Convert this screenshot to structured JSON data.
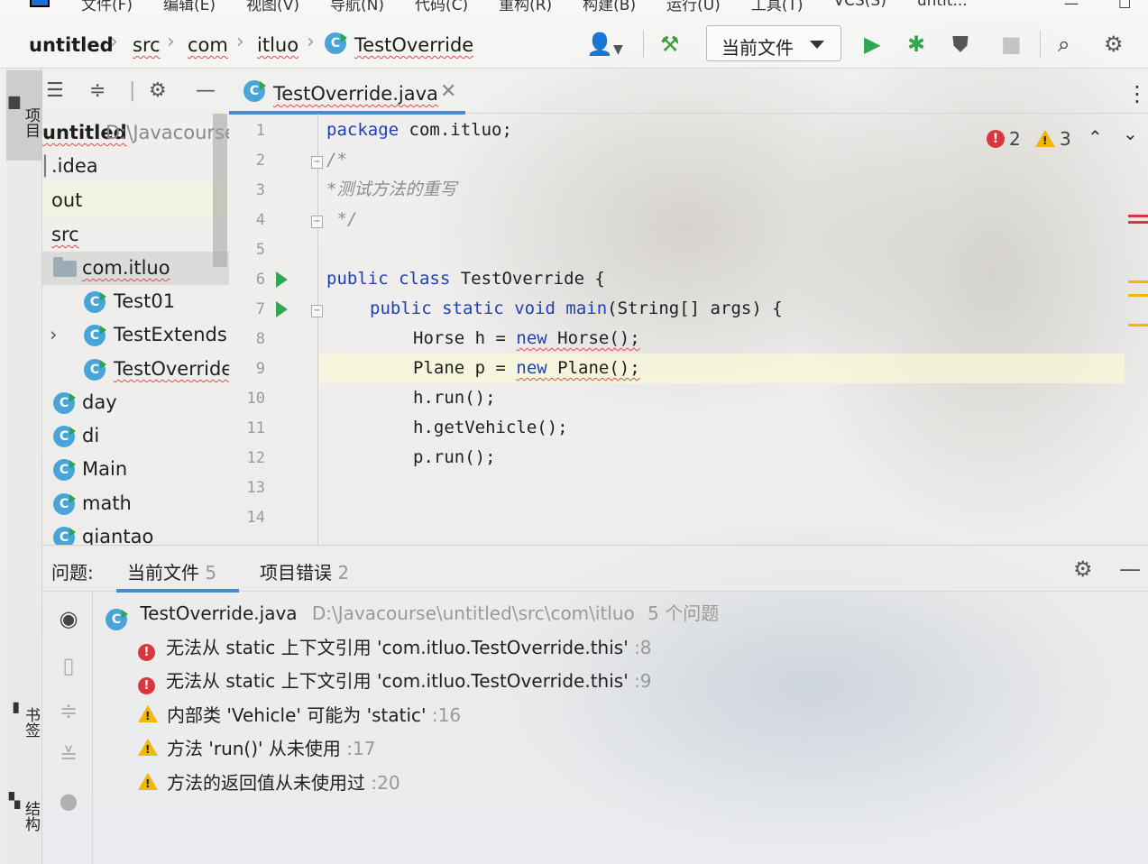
{
  "menubar": {
    "items": [
      "文件(F)",
      "编辑(E)",
      "视图(V)",
      "导航(N)",
      "代码(C)",
      "重构(R)",
      "构建(B)",
      "运行(U)",
      "工具(T)",
      "VCS(S)",
      "untit..."
    ]
  },
  "breadcrumb": {
    "items": [
      "untitled",
      "src",
      "com",
      "itluo",
      "TestOverride"
    ]
  },
  "toolbar": {
    "run_config": "当前文件",
    "icons": [
      "user-icon",
      "hammer-icon",
      "run-icon",
      "debug-icon",
      "coverage-icon",
      "stop-icon",
      "search-icon",
      "gear-icon"
    ]
  },
  "left_stripe": {
    "project_tab": "项目",
    "bookmarks_tab": "书签",
    "structure_tab": "结构"
  },
  "project_tree": {
    "root_name": "untitled",
    "root_path": "D:\\Javacourse",
    "items": [
      {
        "label": ".idea"
      },
      {
        "label": "out"
      },
      {
        "label": "src"
      },
      {
        "label": "com.itluo"
      },
      {
        "label": "Test01"
      },
      {
        "label": "TestExtends."
      },
      {
        "label": "TestOverride"
      },
      {
        "label": "day"
      },
      {
        "label": "di"
      },
      {
        "label": "Main"
      },
      {
        "label": "math"
      },
      {
        "label": "qiantao"
      }
    ]
  },
  "editor": {
    "tab_label": "TestOverride.java",
    "line_numbers": [
      "1",
      "2",
      "3",
      "4",
      "5",
      "6",
      "7",
      "8",
      "9",
      "10",
      "11",
      "12",
      "13",
      "14"
    ],
    "errors": "2",
    "warnings": "3",
    "code": {
      "l1": {
        "kw": "package",
        "rest": " com.itluo;"
      },
      "l2": "/*",
      "l3": "*测试方法的重写",
      "l4": " */",
      "l6": {
        "kw1": "public",
        "kw2": "class",
        "rest": " TestOverride {"
      },
      "l7": {
        "kw1": "public",
        "kw2": "static",
        "kw3": "void",
        "fn": "main",
        "rest": "(String[] args) {"
      },
      "l8": {
        "pre": "Horse h = ",
        "kw": "new",
        "rest": " Horse();"
      },
      "l9": {
        "pre": "Plane p = ",
        "kw": "new",
        "rest": " Plane();"
      },
      "l10": "h.run();",
      "l11": "h.getVehicle();",
      "l12": "p.run();"
    }
  },
  "problems": {
    "title": "问题:",
    "tab_current": "当前文件",
    "tab_current_count": "5",
    "tab_project": "项目错误",
    "tab_project_count": "2",
    "file_name": "TestOverride.java",
    "file_path": "D:\\Javacourse\\untitled\\src\\com\\itluo",
    "file_summary": "5 个问题",
    "items": [
      {
        "severity": "error",
        "text": "无法从 static 上下文引用 'com.itluo.TestOverride.this'",
        "line": ":8"
      },
      {
        "severity": "error",
        "text": "无法从 static 上下文引用 'com.itluo.TestOverride.this'",
        "line": ":9"
      },
      {
        "severity": "warning",
        "text": "内部类 'Vehicle' 可能为 'static'",
        "line": ":16"
      },
      {
        "severity": "warning",
        "text": "方法 'run()' 从未使用",
        "line": ":17"
      },
      {
        "severity": "warning",
        "text": "方法的返回值从未使用过",
        "line": ":20"
      }
    ]
  },
  "colors": {
    "accent": "#4a88d0",
    "error": "#d9363e",
    "warning": "#f2b705",
    "run": "#2fa84f",
    "keyword": "#1f3fb6"
  }
}
